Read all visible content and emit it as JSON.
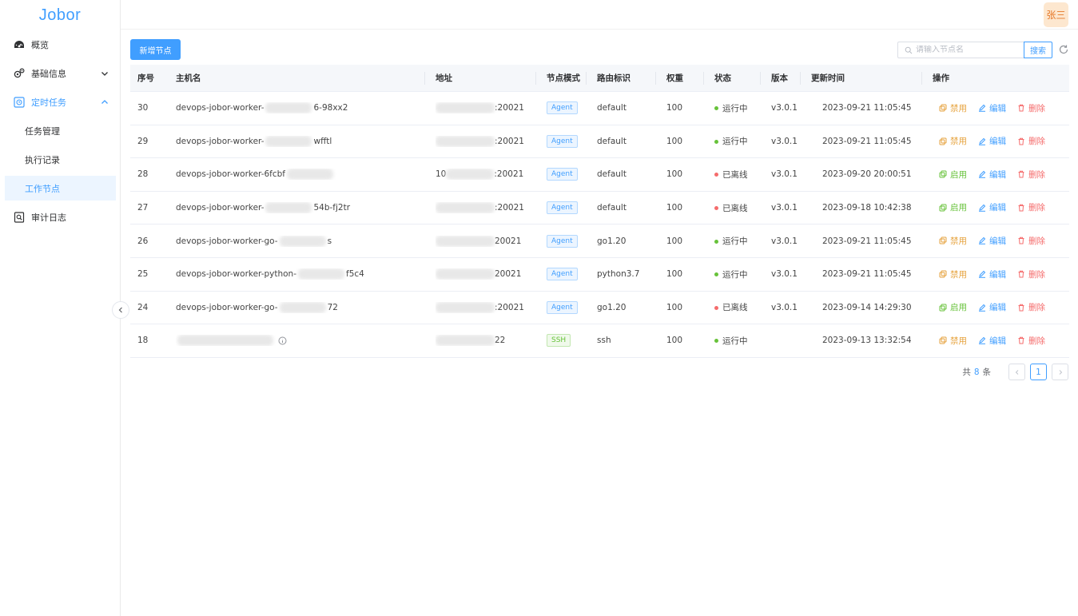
{
  "app": {
    "logo": "Jobor"
  },
  "user": {
    "name": "张三"
  },
  "sidebar": {
    "items": [
      {
        "label": "概览"
      },
      {
        "label": "基础信息"
      },
      {
        "label": "定时任务"
      },
      {
        "label": "审计日志"
      }
    ],
    "subitems": [
      {
        "label": "任务管理"
      },
      {
        "label": "执行记录"
      },
      {
        "label": "工作节点"
      }
    ]
  },
  "toolbar": {
    "add_label": "新增节点",
    "search_placeholder": "请输入节点名",
    "search_label": "搜索"
  },
  "table": {
    "headers": [
      "序号",
      "主机名",
      "地址",
      "节点模式",
      "路由标识",
      "权重",
      "状态",
      "版本",
      "更新时间",
      "操作"
    ],
    "rows": [
      {
        "no": "30",
        "host": "devops-jobor-worker-",
        "host_tail": "6-98xx2",
        "addr_tail": ":20021",
        "mode": "Agent",
        "route": "default",
        "weight": "100",
        "status": "运行中",
        "status_color": "#67c23a",
        "version": "v3.0.1",
        "time": "2023-09-21 11:05:45",
        "toggle": "禁用"
      },
      {
        "no": "29",
        "host": "devops-jobor-worker-",
        "host_tail": "wfftl",
        "addr_tail": ":20021",
        "mode": "Agent",
        "route": "default",
        "weight": "100",
        "status": "运行中",
        "status_color": "#67c23a",
        "version": "v3.0.1",
        "time": "2023-09-21 11:05:45",
        "toggle": "禁用"
      },
      {
        "no": "28",
        "host": "devops-jobor-worker-6fcbf",
        "host_tail": "",
        "addr_tail": ":20021",
        "addr_head": "10",
        "mode": "Agent",
        "route": "default",
        "weight": "100",
        "status": "已离线",
        "status_color": "#f56c6c",
        "version": "v3.0.1",
        "time": "2023-09-20 20:00:51",
        "toggle": "启用"
      },
      {
        "no": "27",
        "host": "devops-jobor-worker-",
        "host_tail": "54b-fj2tr",
        "addr_tail": ":20021",
        "mode": "Agent",
        "route": "default",
        "weight": "100",
        "status": "已离线",
        "status_color": "#f56c6c",
        "version": "v3.0.1",
        "time": "2023-09-18 10:42:38",
        "toggle": "启用"
      },
      {
        "no": "26",
        "host": "devops-jobor-worker-go-",
        "host_tail": "s",
        "addr_tail": "20021",
        "mode": "Agent",
        "route": "go1.20",
        "weight": "100",
        "status": "运行中",
        "status_color": "#67c23a",
        "version": "v3.0.1",
        "time": "2023-09-21 11:05:45",
        "toggle": "禁用"
      },
      {
        "no": "25",
        "host": "devops-jobor-worker-python-",
        "host_tail": "f5c4",
        "addr_tail": "20021",
        "mode": "Agent",
        "route": "python3.7",
        "weight": "100",
        "status": "运行中",
        "status_color": "#67c23a",
        "version": "v3.0.1",
        "time": "2023-09-21 11:05:45",
        "toggle": "禁用"
      },
      {
        "no": "24",
        "host": "devops-jobor-worker-go-",
        "host_tail": "72",
        "addr_tail": ":20021",
        "mode": "Agent",
        "route": "go1.20",
        "weight": "100",
        "status": "已离线",
        "status_color": "#f56c6c",
        "version": "v3.0.1",
        "time": "2023-09-14 14:29:30",
        "toggle": "启用"
      },
      {
        "no": "18",
        "host": "",
        "host_tail": "",
        "addr_tail": "22",
        "mode": "SSH",
        "route": "ssh",
        "weight": "100",
        "status": "运行中",
        "status_color": "#67c23a",
        "version": "",
        "time": "2023-09-13 13:32:54",
        "toggle": "禁用"
      }
    ],
    "edit_label": "编辑",
    "delete_label": "删除"
  },
  "pagination": {
    "prefix": "共",
    "total": "8",
    "suffix": "条",
    "current": "1"
  },
  "colors": {
    "primary": "#409eff",
    "success": "#67c23a",
    "warning": "#e6a23c",
    "danger": "#f56c6c"
  }
}
